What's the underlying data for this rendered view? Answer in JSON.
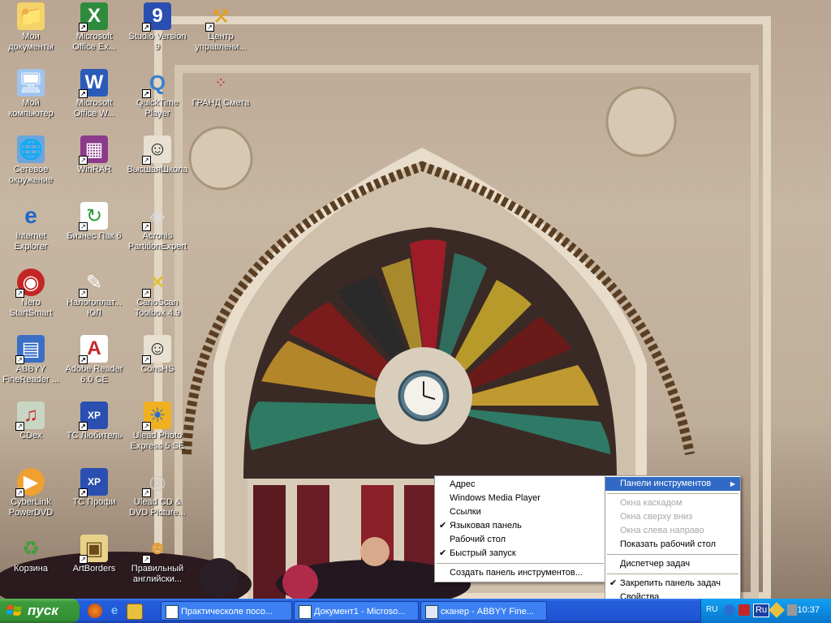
{
  "desktop": {
    "icons": [
      {
        "label": "Мои документы",
        "icon": "folder-icon",
        "shortcut": false
      },
      {
        "label": "Microsoft Office Ex...",
        "icon": "excel-icon",
        "shortcut": true
      },
      {
        "label": "Studio Version 9",
        "icon": "studio-icon",
        "shortcut": true
      },
      {
        "label": "Центр управлени...",
        "icon": "worker-icon",
        "shortcut": true
      },
      {
        "label": "Мой компьютер",
        "icon": "computer-icon",
        "shortcut": false
      },
      {
        "label": "Microsoft Office W...",
        "icon": "word-icon",
        "shortcut": true
      },
      {
        "label": "QuickTime Player",
        "icon": "quicktime-icon",
        "shortcut": true
      },
      {
        "label": "ГРАНД Смета",
        "icon": "grand-icon",
        "shortcut": false
      },
      {
        "label": "Сетевое окружение",
        "icon": "network-icon",
        "shortcut": false
      },
      {
        "label": "WinRAR",
        "icon": "winrar-icon",
        "shortcut": true
      },
      {
        "label": "ВысшаяШкола",
        "icon": "school-icon",
        "shortcut": true
      },
      {
        "label": "Internet Explorer",
        "icon": "ie-icon",
        "shortcut": false
      },
      {
        "label": "Бизнес Пак 6",
        "icon": "business-icon",
        "shortcut": true
      },
      {
        "label": "Acronis PartitionExpert",
        "icon": "acronis-icon",
        "shortcut": true
      },
      {
        "label": "Nero StartSmart",
        "icon": "nero-icon",
        "shortcut": true
      },
      {
        "label": "Налогоплат... ЮЛ",
        "icon": "tax-icon",
        "shortcut": true
      },
      {
        "label": "CanoScan Toolbox 4.9",
        "icon": "canoscan-icon",
        "shortcut": true
      },
      {
        "label": "ABBYY FineReader ...",
        "icon": "abbyy-icon",
        "shortcut": true
      },
      {
        "label": "Adobe Reader 6.0 CE",
        "icon": "adobe-icon",
        "shortcut": true
      },
      {
        "label": "ConsHS",
        "icon": "school-icon",
        "shortcut": true
      },
      {
        "label": "CDex",
        "icon": "cdex-icon",
        "shortcut": true
      },
      {
        "label": "ТС Любитель",
        "icon": "floppy-icon",
        "shortcut": true
      },
      {
        "label": "Ulead Photo Express 5 SE",
        "icon": "ulead-icon",
        "shortcut": true
      },
      {
        "label": "CyberLink PowerDVD",
        "icon": "dvd-icon",
        "shortcut": true
      },
      {
        "label": "ТС Профи",
        "icon": "floppy-icon",
        "shortcut": true
      },
      {
        "label": "Ulead CD & DVD Picture...",
        "icon": "cd-icon",
        "shortcut": true
      },
      {
        "label": "Корзина",
        "icon": "recycle-bin-icon",
        "shortcut": false
      },
      {
        "label": "ArtBorders",
        "icon": "artborders-icon",
        "shortcut": true
      },
      {
        "label": "Правильный английски...",
        "icon": "english-icon",
        "shortcut": true
      }
    ]
  },
  "toolbar_menu": {
    "items": [
      {
        "label": "Адрес",
        "checked": false
      },
      {
        "label": "Windows Media Player",
        "checked": false
      },
      {
        "label": "Ссылки",
        "checked": false
      },
      {
        "label": "Языковая панель",
        "checked": true
      },
      {
        "label": "Рабочий стол",
        "checked": false
      },
      {
        "label": "Быстрый запуск",
        "checked": true
      }
    ],
    "create": "Создать панель инструментов..."
  },
  "taskbar_menu": {
    "toolbars": "Панели инструментов",
    "cascade": "Окна каскадом",
    "tile_h": "Окна сверху вниз",
    "tile_v": "Окна слева направо",
    "show_desktop": "Показать рабочий стол",
    "task_manager": "Диспетчер задач",
    "lock": "Закрепить панель задач",
    "properties": "Свойства"
  },
  "taskbar": {
    "start": "пуск",
    "tasks": [
      {
        "label": "Практическоле посо..."
      },
      {
        "label": "Документ1 - Microso..."
      },
      {
        "label": "сканер - ABBYY Fine..."
      }
    ],
    "tray": {
      "lang_small": "RU",
      "lang": "Ru",
      "time": "10:37"
    }
  },
  "colors": {
    "taskbar": "#245edb",
    "start": "#3c9b3c",
    "menu_highlight": "#316ac5"
  }
}
